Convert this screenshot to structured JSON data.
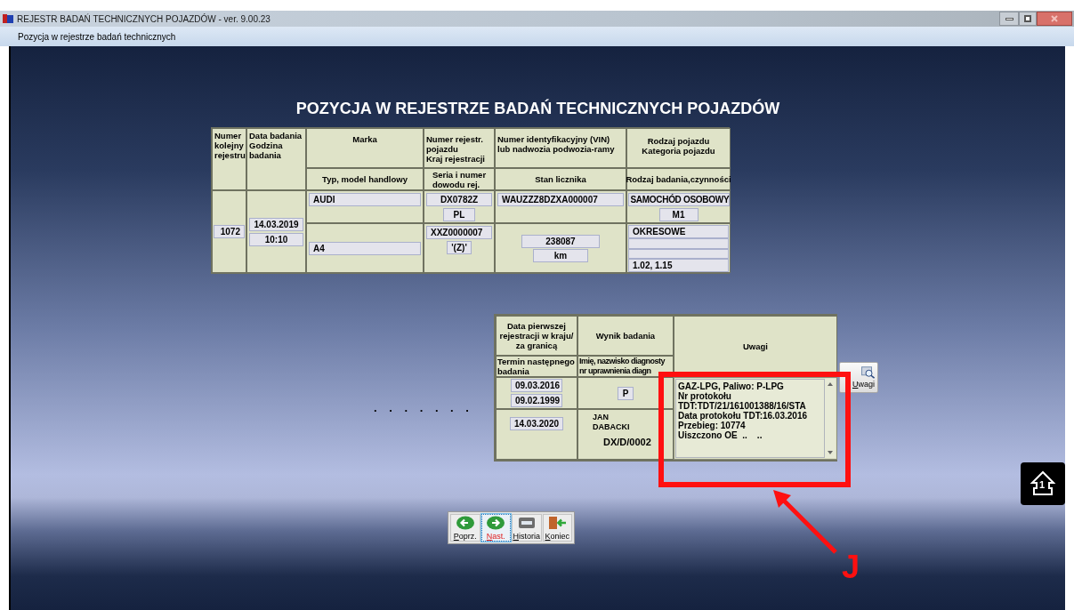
{
  "window": {
    "title": "REJESTR BADAŃ TECHNICZNYCH POJAZDÓW -  ver. 9.00.23"
  },
  "subtitle": "Pozycja w rejestrze badań technicznych",
  "heading": "POZYCJA W REJESTRZE BADAŃ TECHNICZNYCH POJAZDÓW",
  "register_table": {
    "headers": {
      "number": "Numer\nkolejny\nrejestru",
      "date": "Data badania\nGodzina\nbadania",
      "make": "Marka",
      "reg": "Numer rejestr.\npojazdu\nKraj rejestracji",
      "vin": "Numer identyfikacyjny (VIN)\nlub nadwozia podwozia-ramy",
      "type": "Rodzaj pojazdu\nKategoria pojazdu",
      "model": "Typ, model handlowy",
      "doc": "Seria i numer\ndowodu rej.",
      "odometer": "Stan licznika",
      "exam": "Rodzaj badania,czynności"
    },
    "number": "1072",
    "date": "14.03.2019",
    "time": "10:10",
    "make": "AUDI",
    "model": "A4",
    "reg": "DX0782Z",
    "country": "PL",
    "doc": "XXZ0000007",
    "doc_mark": "'(Z)'",
    "vin": "WAUZZZ8DZXA000007",
    "odometer": "238087",
    "unit": "km",
    "vehicle_type": "SAMOCHÓD OSOBOWY",
    "category": "M1",
    "exam_type": "OKRESOWE",
    "activities": "1.02, 1.15"
  },
  "dots": ". . . . . . .",
  "result_table": {
    "headers": {
      "first_reg": "Data pierwszej\nrejestracji w kraju/\nza granicą",
      "result": "Wynik badania",
      "remarks": "Uwagi",
      "next": "Termin następnego\nbadania",
      "diagnostician": "Imię, nazwisko diagnosty\nnr uprawnienia diagn"
    },
    "first_reg_country": "09.03.2016",
    "first_reg_abroad": "09.02.1999",
    "next": "14.03.2020",
    "result": "P",
    "diagnostician": "JAN\nDABACKI",
    "licence": "DX/D/0002",
    "remarks": [
      "GAZ-LPG, Paliwo: P-LPG",
      "Nr protokołu",
      "TDT:TDT/21/161001388/16/STA",
      "Data protokołu TDT:16.03.2016",
      "Przebieg: 10774",
      "Uiszczono OE  ..    .."
    ],
    "remarks_button": "Uwagi"
  },
  "toolbar": [
    {
      "kind": "prev",
      "label": "Poprz.",
      "selected": false
    },
    {
      "kind": "next",
      "label": "Nast.",
      "selected": true
    },
    {
      "kind": "history",
      "label": "Historia",
      "selected": false
    },
    {
      "kind": "exit",
      "label": "Koniec",
      "selected": false
    }
  ],
  "home_button": {
    "label": "1"
  },
  "annotation": {
    "label": "J"
  }
}
